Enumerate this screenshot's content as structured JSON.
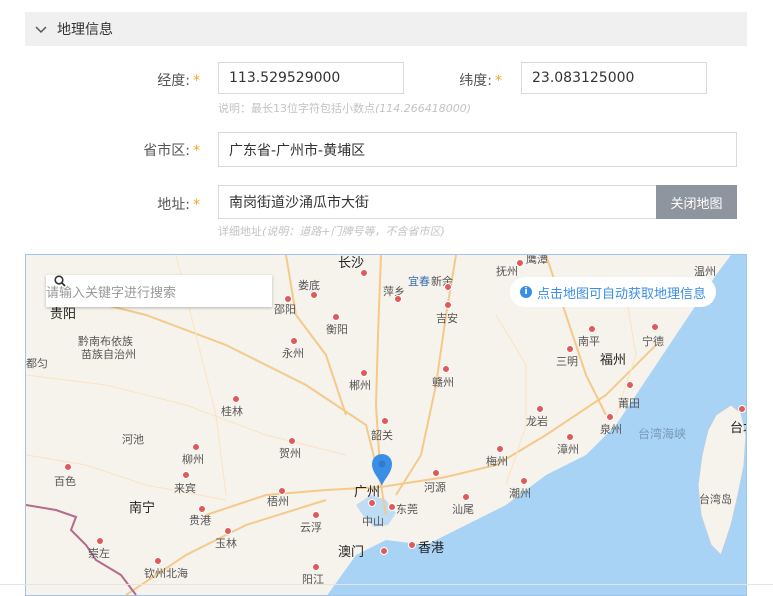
{
  "section": {
    "title": "地理信息"
  },
  "form": {
    "longitude_label": "经度:",
    "longitude_value": "113.529529000",
    "latitude_label": "纬度:",
    "latitude_value": "23.083125000",
    "required_mark": "*",
    "coord_hint": "说明：最长13位字符包括小数点",
    "coord_hint_example": "(114.266418000)",
    "region_label": "省市区:",
    "region_value": "广东省-广州市-黄埔区",
    "address_label": "地址:",
    "address_value": "南岗街道沙涌瓜市大街",
    "close_map_label": "关闭地图",
    "address_hint": "详细地址",
    "address_hint_example": "(说明：道路+门牌号等，不含省市区)"
  },
  "map": {
    "search_placeholder": "请输入关键字进行搜索",
    "tip": "点击地图可自动获取地理信息",
    "colors": {
      "land": "#f6f3ec",
      "sea": "#a9d3f5",
      "road": "#f5c98a",
      "pin": "#3a8ee6",
      "city_dot": "#e05a5a"
    },
    "labels": {
      "changsha": "长沙",
      "yichun": "宜春",
      "xinyu": "新余",
      "fuzhou_jx": "抚州",
      "yingtan": "鹰潭",
      "wenzhou": "温州",
      "loudi": "娄底",
      "pingxiang": "萍乡",
      "guiyang": "贵阳",
      "shaoyang": "邵阳",
      "hengyang": "衡阳",
      "jian": "吉安",
      "nanping": "南平",
      "ningde": "宁德",
      "qiandongnan": "黔南布依族\n苗族自治州",
      "sanming": "三明",
      "fuzhou": "福州",
      "yongzhou": "永州",
      "duyun": "都匀",
      "chenzhou": "郴州",
      "ganzhou": "赣州",
      "putian": "莆田",
      "guilin": "桂林",
      "longyan": "龙岩",
      "quanzhou": "泉州",
      "taipei": "台北",
      "hechi": "河池",
      "shaoguan": "韶关",
      "zhangzhou": "漳州",
      "strait": "台湾海峡",
      "liuzhou": "柳州",
      "hezhou": "贺州",
      "meizhou": "梅州",
      "baise": "百色",
      "laibin": "来宾",
      "guangzhou": "广州",
      "heyuan": "河源",
      "chaozhou": "潮州",
      "taiwan": "台湾岛",
      "nanning": "南宁",
      "wuzhou": "梧州",
      "dongguan": "东莞",
      "shanwei": "汕尾",
      "guigang": "贵港",
      "yunfu": "云浮",
      "zhongshan": "中山",
      "yulin": "玉林",
      "macau": "澳门",
      "hongkong": "香港",
      "chongzuo": "崇左",
      "qinzhou_beihai": "钦州北海",
      "yangjiang": "阳江"
    }
  }
}
